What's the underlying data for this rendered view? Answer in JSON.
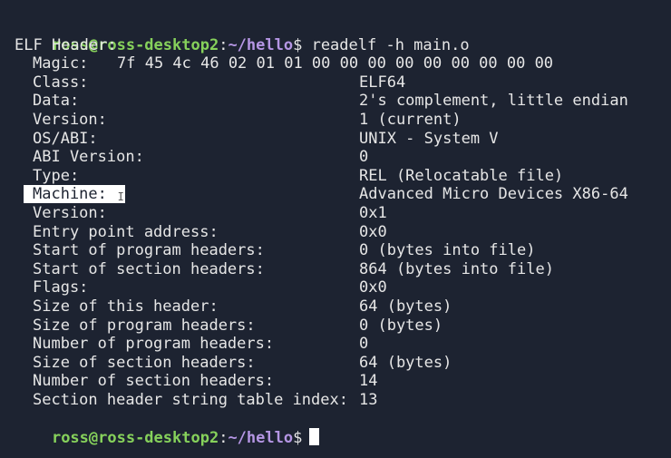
{
  "prompt": {
    "user_host": "ross@ross-desktop2",
    "colon": ":",
    "path": "~/hello",
    "dollar": "$",
    "command": " readelf -h main.o"
  },
  "header_title": "ELF Header:",
  "magic": {
    "label": "Magic:",
    "values": "7f 45 4c 46 02 01 01 00 00 00 00 00 00 00 00 00"
  },
  "fields": [
    {
      "label": "Class:",
      "value": "ELF64"
    },
    {
      "label": "Data:",
      "value": "2's complement, little endian"
    },
    {
      "label": "Version:",
      "value": "1 (current)"
    },
    {
      "label": "OS/ABI:",
      "value": "UNIX - System V"
    },
    {
      "label": "ABI Version:",
      "value": "0"
    },
    {
      "label": "Type:",
      "value": "REL (Relocatable file)"
    },
    {
      "label": "Machine:",
      "value": "Advanced Micro Devices X86-64"
    },
    {
      "label": "Version:",
      "value": "0x1"
    },
    {
      "label": "Entry point address:",
      "value": "0x0"
    },
    {
      "label": "Start of program headers:",
      "value": "0 (bytes into file)"
    },
    {
      "label": "Start of section headers:",
      "value": "864 (bytes into file)"
    },
    {
      "label": "Flags:",
      "value": "0x0"
    },
    {
      "label": "Size of this header:",
      "value": "64 (bytes)"
    },
    {
      "label": "Size of program headers:",
      "value": "0 (bytes)"
    },
    {
      "label": "Number of program headers:",
      "value": "0"
    },
    {
      "label": "Size of section headers:",
      "value": "64 (bytes)"
    },
    {
      "label": "Number of section headers:",
      "value": "14"
    },
    {
      "label": "Section header string table index:",
      "value": "13"
    }
  ],
  "selection": {
    "selected_field_index": 6,
    "cursor_icon": "text-cursor-ibeam-icon"
  },
  "colors": {
    "background": "#1d2331",
    "text": "#e6e6e6",
    "prompt_user": "#86d15b",
    "prompt_path": "#b596e4"
  }
}
